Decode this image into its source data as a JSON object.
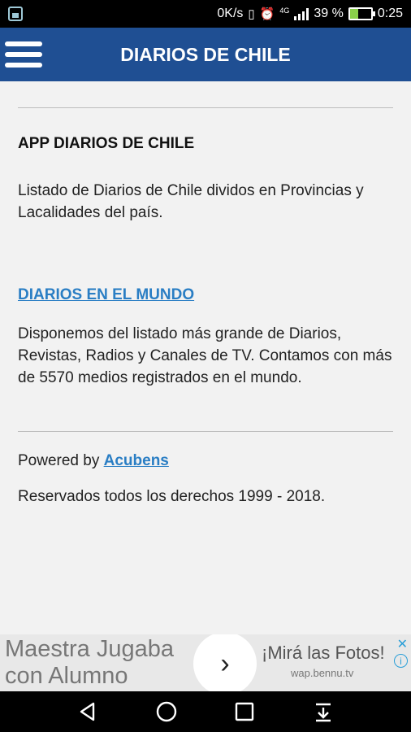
{
  "status_bar": {
    "network_speed": "0K/s",
    "network_type": "4G",
    "battery_percent": "39 %",
    "battery_level": 0.39,
    "time": "0:25"
  },
  "app_bar": {
    "title": "DIARIOS DE CHILE"
  },
  "content": {
    "heading": "APP DIARIOS DE CHILE",
    "description": "Listado de Diarios de Chile dividos en Provincias y Lacalidades del país.",
    "world_link": "DIARIOS EN EL MUNDO",
    "world_description": "Disponemos del listado más grande de Diarios, Revistas, Radios y Canales de TV. Contamos con más de 5570 medios registrados en el mundo.",
    "powered_prefix": "Powered by ",
    "powered_link": "Acubens",
    "rights": "Reservados todos los derechos 1999 - 2018."
  },
  "ad": {
    "headline": "Maestra Jugaba con Alumno",
    "cta": "¡Mirá las Fotos!",
    "domain": "wap.bennu.tv"
  },
  "colors": {
    "app_bar": "#1f4f93",
    "link": "#2a7ec4"
  }
}
